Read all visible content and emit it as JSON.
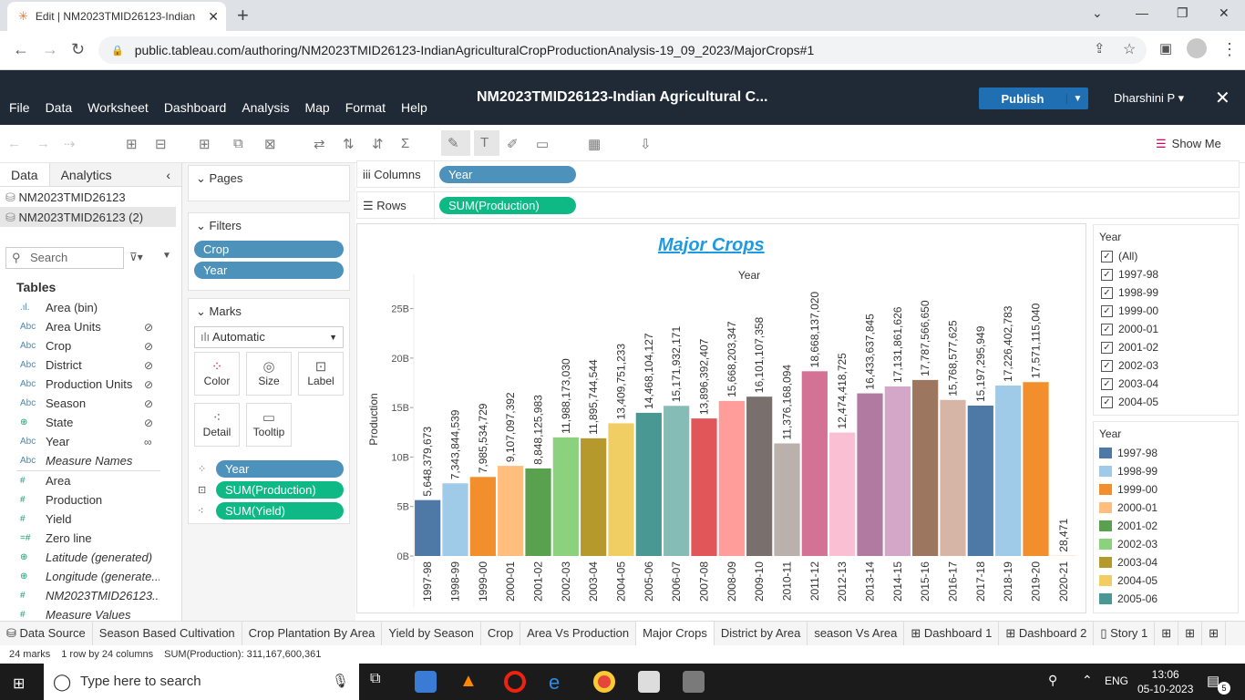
{
  "browser": {
    "tab_title": "Edit | NM2023TMID26123-Indian",
    "url": "public.tableau.com/authoring/NM2023TMID26123-IndianAgriculturalCropProductionAnalysis-19_09_2023/MajorCrops#1"
  },
  "header": {
    "menus": [
      "File",
      "Data",
      "Worksheet",
      "Dashboard",
      "Analysis",
      "Map",
      "Format",
      "Help"
    ],
    "workbook_title": "NM2023TMID26123-Indian Agricultural C...",
    "publish_label": "Publish",
    "user": "Dharshini P ▾",
    "show_me": "Show Me"
  },
  "data_pane": {
    "tabs": [
      "Data",
      "Analytics"
    ],
    "datasources": [
      "NM2023TMID26123",
      "NM2023TMID26123 (2)"
    ],
    "search_placeholder": "Search",
    "tables_label": "Tables",
    "fields": [
      {
        "type": ".ıl.",
        "name": "Area (bin)",
        "linked": false
      },
      {
        "type": "Abc",
        "name": "Area Units",
        "linked": true
      },
      {
        "type": "Abc",
        "name": "Crop",
        "linked": true
      },
      {
        "type": "Abc",
        "name": "District",
        "linked": true
      },
      {
        "type": "Abc",
        "name": "Production Units",
        "linked": true
      },
      {
        "type": "Abc",
        "name": "Season",
        "linked": true
      },
      {
        "type": "⊕",
        "name": "State",
        "linked": true
      },
      {
        "type": "Abc",
        "name": "Year",
        "linked": true
      },
      {
        "type": "Abc",
        "name": "Measure Names",
        "linked": false
      },
      {
        "type": "#",
        "name": "Area",
        "linked": false
      },
      {
        "type": "#",
        "name": "Production",
        "linked": false
      },
      {
        "type": "#",
        "name": "Yield",
        "linked": false
      },
      {
        "type": "=#",
        "name": "Zero line",
        "linked": false
      },
      {
        "type": "⊕",
        "name": "Latitude (generated)",
        "linked": false
      },
      {
        "type": "⊕",
        "name": "Longitude (generate...",
        "linked": false
      },
      {
        "type": "#",
        "name": "NM2023TMID26123...",
        "linked": false
      },
      {
        "type": "#",
        "name": "Measure Values",
        "linked": false
      }
    ]
  },
  "cards": {
    "pages_label": "Pages",
    "filters_label": "Filters",
    "filters": [
      "Crop",
      "Year"
    ],
    "marks_label": "Marks",
    "mark_type": "Automatic",
    "mark_buttons": [
      "Color",
      "Size",
      "Label",
      "Detail",
      "Tooltip"
    ],
    "mark_pills": [
      "Year",
      "SUM(Production)",
      "SUM(Yield)"
    ]
  },
  "shelves": {
    "columns_label": "Columns",
    "columns_pill": "Year",
    "rows_label": "Rows",
    "rows_pill": "SUM(Production)"
  },
  "chart_data": {
    "type": "bar",
    "title": "Major Crops",
    "header_label": "Year",
    "ylabel": "Production",
    "ylim": [
      0,
      28000000000
    ],
    "yticks": [
      "0B",
      "5B",
      "10B",
      "15B",
      "20B",
      "25B"
    ],
    "categories": [
      "1997-98",
      "1998-99",
      "1999-00",
      "2000-01",
      "2001-02",
      "2002-03",
      "2003-04",
      "2004-05",
      "2005-06",
      "2006-07",
      "2007-08",
      "2008-09",
      "2009-10",
      "2010-11",
      "2011-12",
      "2012-13",
      "2013-14",
      "2014-15",
      "2015-16",
      "2016-17",
      "2017-18",
      "2018-19",
      "2019-20",
      "2020-21"
    ],
    "values": [
      5648379673,
      7343844539,
      7985534729,
      9107097392,
      8848125983,
      11988173030,
      11895744544,
      13409751233,
      14468104127,
      15171932171,
      13896392407,
      15668203347,
      16101107358,
      11376168094,
      18668137020,
      12474418725,
      16433637845,
      17131861626,
      17787566650,
      15768577625,
      15197295949,
      17226402783,
      17571115040,
      28471
    ],
    "labels": [
      "5,648,379,673",
      "7,343,844,539",
      "7,985,534,729",
      "9,107,097,392",
      "8,848,125,983",
      "11,988,173,030",
      "11,895,744,544",
      "13,409,751,233",
      "14,468,104,127",
      "15,171,932,171",
      "13,896,392,407",
      "15,668,203,347",
      "16,101,107,358",
      "11,376,168,094",
      "18,668,137,020",
      "12,474,418,725",
      "16,433,637,845",
      "17,131,861,626",
      "17,787,566,650",
      "15,768,577,625",
      "15,197,295,949",
      "17,226,402,783",
      "17,571,115,040",
      "28,471"
    ],
    "colors": [
      "#4e79a7",
      "#a0cbe8",
      "#f28e2b",
      "#ffbe7d",
      "#59a14f",
      "#8cd17d",
      "#b6992d",
      "#f1ce63",
      "#499894",
      "#86bcb6",
      "#e15759",
      "#ff9d9a",
      "#79706e",
      "#bab0ac",
      "#d37295",
      "#fabfd2",
      "#b07aa1",
      "#d4a6c8",
      "#9d7660",
      "#d7b5a6",
      "#4e79a7",
      "#a0cbe8",
      "#f28e2b",
      "#ffbe7d"
    ]
  },
  "year_filter": {
    "title": "Year",
    "items": [
      "(All)",
      "1997-98",
      "1998-99",
      "1999-00",
      "2000-01",
      "2001-02",
      "2002-03",
      "2003-04",
      "2004-05"
    ]
  },
  "color_legend": {
    "title": "Year",
    "items": [
      "1997-98",
      "1998-99",
      "1999-00",
      "2000-01",
      "2001-02",
      "2002-03",
      "2003-04",
      "2004-05",
      "2005-06"
    ]
  },
  "sheet_tabs": [
    "Data Source",
    "Season Based Cultivation",
    "Crop Plantation By Area",
    "Yield by Season",
    "Crop",
    "Area Vs Production",
    "Major Crops",
    "District by Area",
    "season Vs Area",
    "Dashboard 1",
    "Dashboard 2",
    "Story 1"
  ],
  "active_sheet": "Major Crops",
  "status": {
    "marks": "24 marks",
    "dims": "1 row by 24 columns",
    "sum": "SUM(Production): 311,167,600,361"
  },
  "taskbar": {
    "search_placeholder": "Type here to search",
    "lang": "ENG",
    "time": "13:06",
    "date": "05-10-2023",
    "notif_count": "5"
  }
}
